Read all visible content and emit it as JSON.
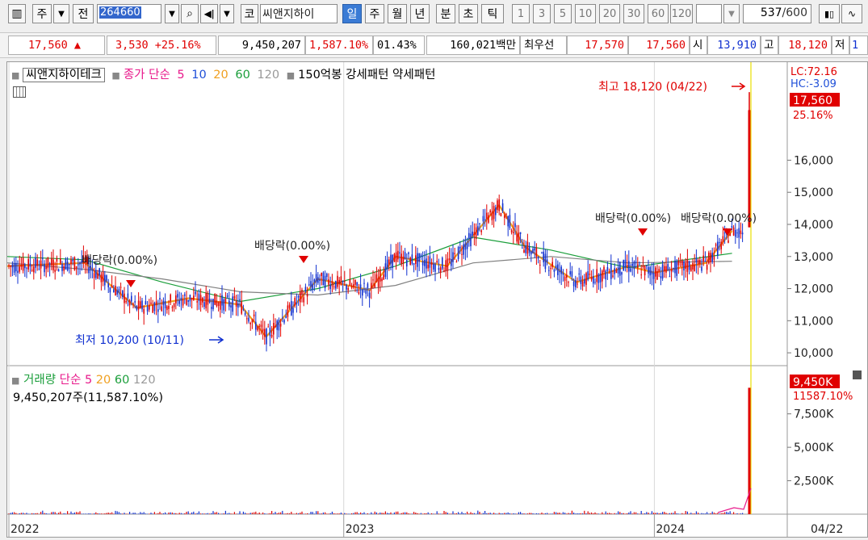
{
  "toolbar": {
    "period_buttons": [
      "일",
      "주",
      "월",
      "년",
      "분",
      "초",
      "틱"
    ],
    "selected_period": "일",
    "minute_buttons": [
      "1",
      "3",
      "5",
      "10",
      "20",
      "30",
      "60",
      "120"
    ],
    "code": "264660",
    "type_label": "주",
    "mode_label": "전",
    "market_label": "코",
    "stock_name": "씨앤지하이",
    "count_current": "537",
    "count_total": "/600"
  },
  "infobar": {
    "price": "17,560",
    "change_arrow": "▲",
    "change": "3,530",
    "change_pct": "+25.16%",
    "volume": "9,450,207",
    "volume_pct": "1,587.10%",
    "turnover": "01.43%",
    "amount": "160,021백만",
    "best_label": "최우선",
    "best_ask": "17,570",
    "best_bid": "17,560",
    "open_label": "시",
    "open": "13,910",
    "high_label": "고",
    "high": "18,120",
    "low_label": "저",
    "low": "1"
  },
  "legend": {
    "stock_name": "씨앤지하이테크",
    "price_ma_label": "종가 단순",
    "ma5": "5",
    "ma10": "10",
    "ma20": "20",
    "ma60": "60",
    "ma120": "120",
    "pattern_label": "150억봉 강세패턴  약세패턴"
  },
  "volume_legend": {
    "label": "거래량",
    "ma_label": "단순",
    "ma5": "5",
    "ma20": "20",
    "ma60": "60",
    "ma120": "120",
    "value_text": "9,450,207주(11,587.10%)"
  },
  "annotations": {
    "high": "최고 18,120 (04/22)",
    "low": "최저 10,200 (10/11)",
    "ex_div_1": "배당락(0.00%)",
    "ex_div_2": "배당락(0.00%)",
    "ex_div_3": "배당락(0.00%)",
    "ex_div_4": "배당락(0.00%)"
  },
  "right_axis": {
    "lc": "LC:72.16",
    "hc": "HC:-3.09",
    "price_tag": "17,560",
    "pct_tag": "25.16%",
    "vol_tag": "9,450K",
    "vol_pct_tag": "11587.10%"
  },
  "x_axis": {
    "labels": [
      "2022",
      "2023",
      "2024"
    ],
    "cursor_date": "04/22"
  },
  "colors": {
    "up": "#e00000",
    "down": "#1030d0",
    "ma5": "#e8198b",
    "ma10": "#1f4fd8",
    "ma20": "#f0a020",
    "ma60": "#1a9e3a",
    "ma120": "#808080",
    "selected": "#3a7bd5"
  },
  "chart_data": {
    "type": "line",
    "price_axis": {
      "ticks": [
        10000,
        11000,
        12000,
        13000,
        14000,
        15000,
        16000
      ],
      "ylim": [
        9600,
        18400
      ]
    },
    "volume_axis": {
      "ticks": [
        "2,500K",
        "5,000K",
        "7,500K"
      ],
      "ylim": [
        0,
        10500000
      ]
    },
    "series": [
      {
        "name": "종가 단순 20",
        "x": [
          "2021-12",
          "2022-03",
          "2022-05",
          "2022-07",
          "2022-09",
          "2022-10",
          "2022-12",
          "2023-02",
          "2023-03",
          "2023-05",
          "2023-07",
          "2023-08",
          "2023-10",
          "2023-12",
          "2024-01",
          "2024-03",
          "2024-04"
        ],
        "values": [
          12700,
          12800,
          11400,
          11700,
          11500,
          10500,
          12300,
          11950,
          13000,
          12700,
          14600,
          13300,
          12200,
          12700,
          12500,
          12800,
          13800
        ]
      },
      {
        "name": "종가 단순 60",
        "x": [
          "2021-12",
          "2022-03",
          "2022-06",
          "2022-09",
          "2022-12",
          "2023-03",
          "2023-06",
          "2023-09",
          "2023-12",
          "2024-04"
        ],
        "values": [
          13000,
          12900,
          12200,
          11600,
          12000,
          12700,
          13600,
          13200,
          12650,
          13100
        ]
      },
      {
        "name": "종가 단순 120",
        "x": [
          "2021-12",
          "2022-03",
          "2022-06",
          "2022-09",
          "2022-12",
          "2023-03",
          "2023-06",
          "2023-09",
          "2023-12",
          "2024-04"
        ],
        "values": [
          12800,
          12600,
          12300,
          11900,
          11800,
          12100,
          12800,
          13000,
          12800,
          12850
        ]
      }
    ],
    "markers": [
      {
        "label": "최고",
        "value": 18120,
        "date": "04/22"
      },
      {
        "label": "최저",
        "value": 10200,
        "date": "10/11"
      }
    ],
    "last_volume": 9450207
  }
}
